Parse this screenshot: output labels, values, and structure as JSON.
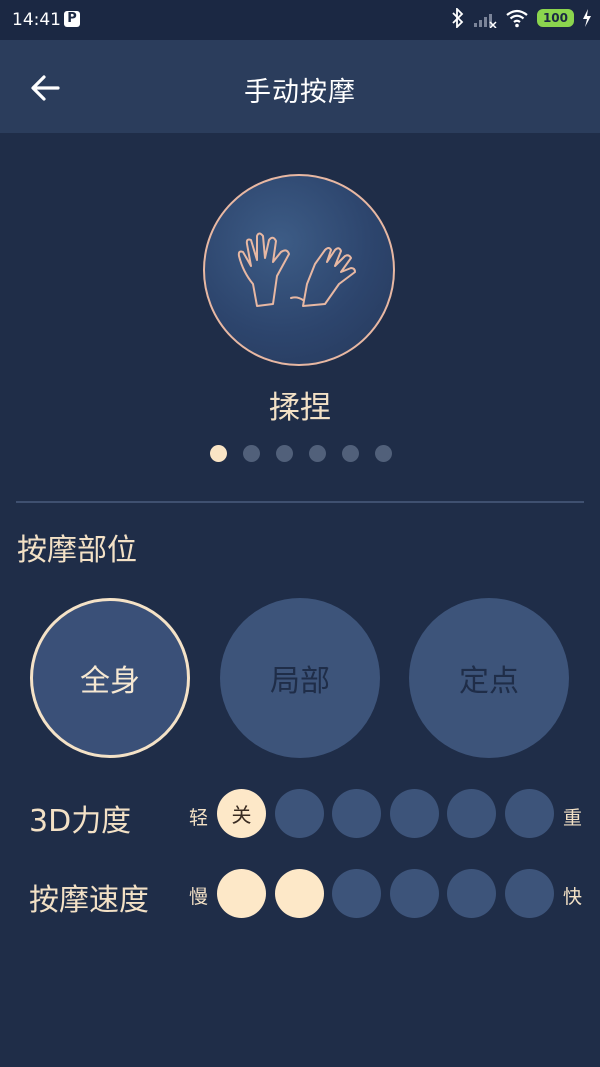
{
  "status": {
    "time": "14:41",
    "battery": "100"
  },
  "header": {
    "title": "手动按摩"
  },
  "mode": {
    "name": "揉捏",
    "page_count": 6,
    "active_page": 0
  },
  "section": {
    "title": "按摩部位"
  },
  "areas": [
    {
      "label": "全身",
      "selected": true
    },
    {
      "label": "局部",
      "selected": false
    },
    {
      "label": "定点",
      "selected": false
    }
  ],
  "intensity": {
    "label": "3D力度",
    "min_label": "轻",
    "max_label": "重",
    "off_label": "关",
    "levels": 6,
    "value": 0
  },
  "speed": {
    "label": "按摩速度",
    "min_label": "慢",
    "max_label": "快",
    "levels": 6,
    "value": 2
  },
  "colors": {
    "background": "#1f2d48",
    "accent": "#fde8c8",
    "inactive": "#3d547a"
  }
}
